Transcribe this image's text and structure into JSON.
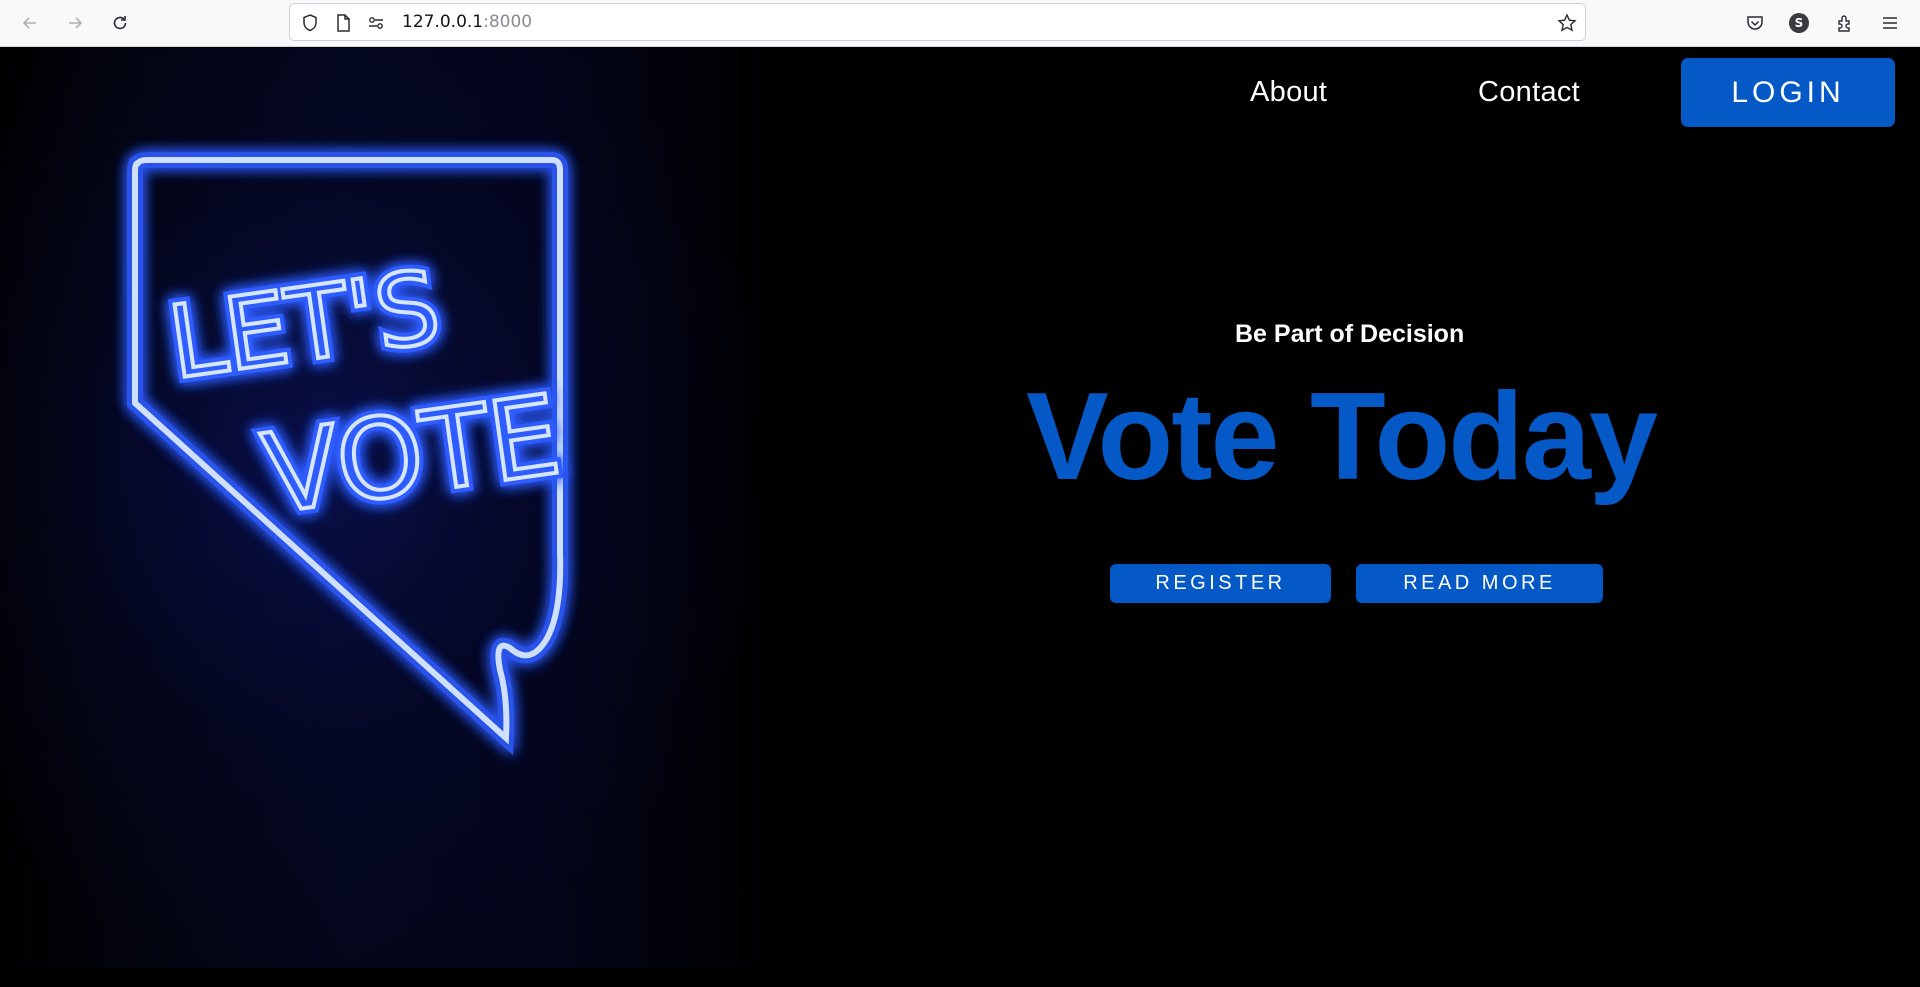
{
  "browser": {
    "url_host": "127.0.0.1",
    "url_port": ":8000",
    "profile_initial": "S"
  },
  "nav": {
    "about": "About",
    "contact": "Contact",
    "login": "LOGIN"
  },
  "hero": {
    "image_sign_text": "LET'S VOTE",
    "tagline": "Be Part of Decision",
    "headline": "Vote Today",
    "register": "REGISTER",
    "read_more": "READ MORE"
  },
  "colors": {
    "accent": "#0459c6",
    "background": "#000000",
    "neon": "#bfd6ff"
  }
}
